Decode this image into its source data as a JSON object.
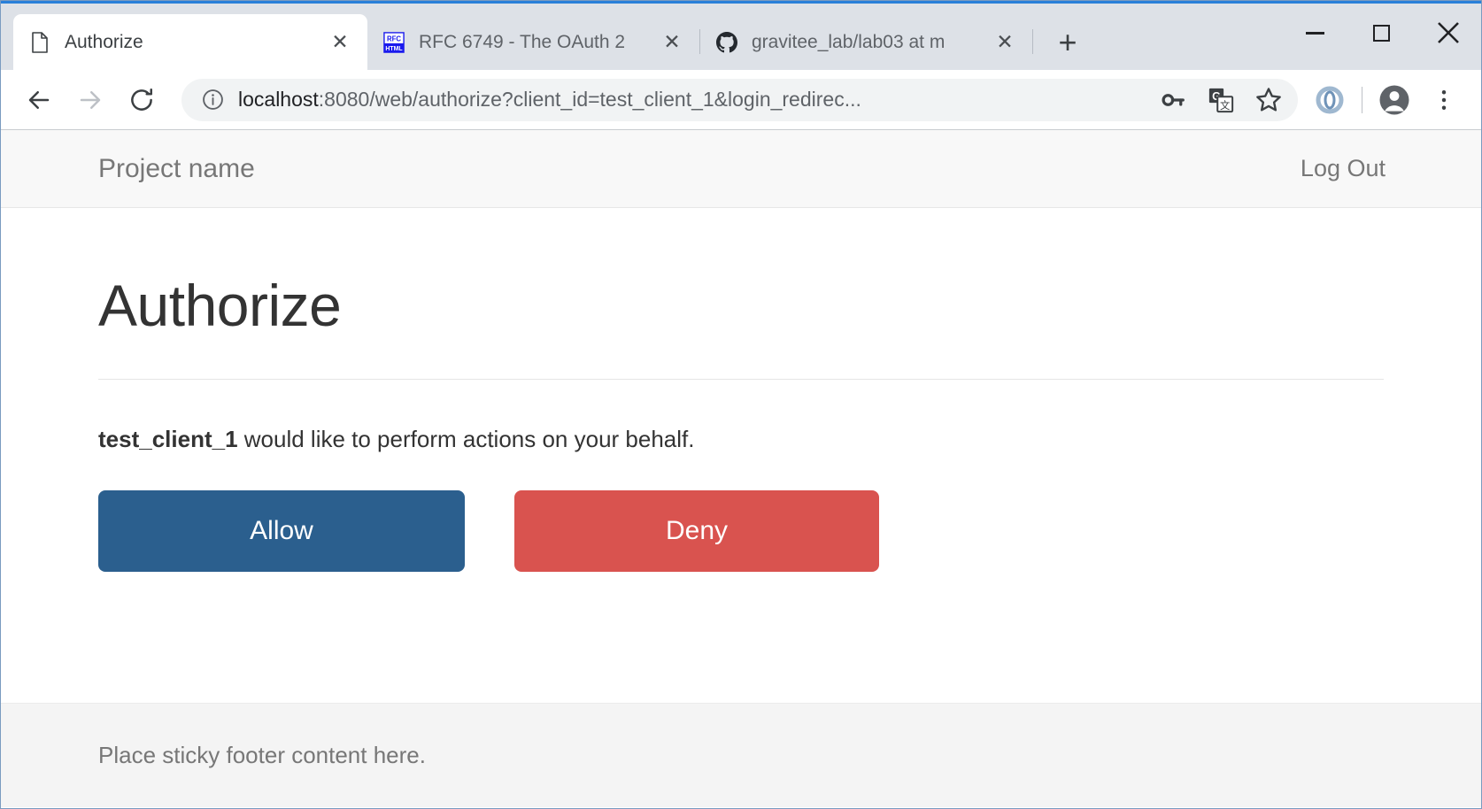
{
  "browser": {
    "tabs": [
      {
        "title": "Authorize",
        "favicon": "document-icon",
        "active": true,
        "close_label": "✕"
      },
      {
        "title": "RFC 6749 - The OAuth 2",
        "favicon": "rfc-html-icon",
        "active": false,
        "close_label": "✕"
      },
      {
        "title": "gravitee_lab/lab03 at m",
        "favicon": "github-icon",
        "active": false,
        "close_label": "✕"
      }
    ],
    "new_tab_label": "+",
    "window_controls": {
      "minimize": "minimize-icon",
      "maximize": "maximize-icon",
      "close": "✕"
    },
    "toolbar": {
      "back": "back-arrow-icon",
      "forward": "forward-arrow-icon",
      "reload": "reload-icon",
      "site_info": "info-icon",
      "password_manager": "key-icon",
      "translate": "translate-icon",
      "bookmark": "star-icon",
      "extension": "extension-icon",
      "profile": "avatar-icon",
      "menu": "three-dot-menu-icon"
    },
    "omnibox": {
      "host": "localhost",
      "path": ":8080/web/authorize?client_id=test_client_1&login_redirec...",
      "full_url": "localhost:8080/web/authorize?client_id=test_client_1&login_redirec..."
    }
  },
  "page": {
    "navbar": {
      "brand": "Project name",
      "logout": "Log Out"
    },
    "title": "Authorize",
    "description": {
      "client_id": "test_client_1",
      "rest": " would like to perform actions on your behalf."
    },
    "buttons": {
      "allow": "Allow",
      "deny": "Deny"
    },
    "footer": "Place sticky footer content here."
  },
  "colors": {
    "allow": "#2b5f8e",
    "deny": "#d9534f",
    "tabstrip": "#dde1e7",
    "accent_top": "#2980d9",
    "muted_text": "#777777",
    "heading": "#333333"
  }
}
